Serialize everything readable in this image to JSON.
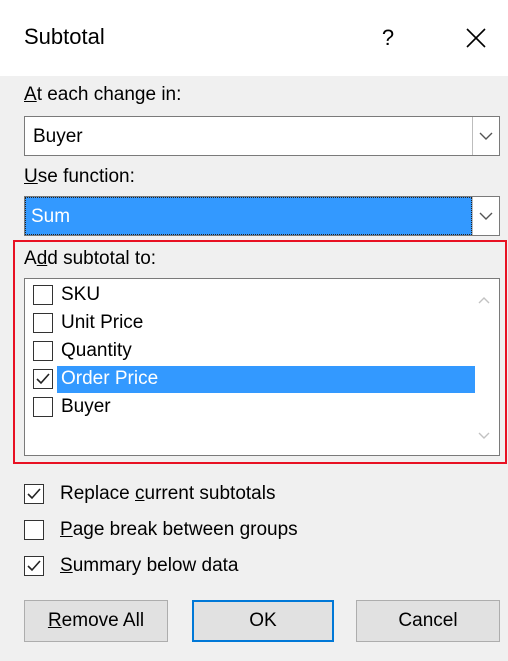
{
  "dialog": {
    "title": "Subtotal",
    "help_label": "?"
  },
  "change": {
    "label_access": "A",
    "label_rest": "t each change in:",
    "value": "Buyer"
  },
  "function": {
    "label_access": "U",
    "label_rest": "se function:",
    "value": "Sum"
  },
  "add_to": {
    "label_pre": "A",
    "label_access": "d",
    "label_rest": "d subtotal to:",
    "items": [
      {
        "label": "SKU",
        "checked": false
      },
      {
        "label": "Unit Price",
        "checked": false
      },
      {
        "label": "Quantity",
        "checked": false
      },
      {
        "label": "Order Price",
        "checked": true,
        "selected": true
      },
      {
        "label": "Buyer",
        "checked": false
      }
    ]
  },
  "options": {
    "replace": {
      "pre": "Replace ",
      "access": "c",
      "rest": "urrent subtotals",
      "checked": true
    },
    "page_break": {
      "pre": "",
      "access": "P",
      "rest": "age break between groups",
      "checked": false
    },
    "summary": {
      "pre": "",
      "access": "S",
      "rest": "ummary below data",
      "checked": true
    }
  },
  "buttons": {
    "remove_access": "R",
    "remove_rest": "emove All",
    "ok": "OK",
    "cancel": "Cancel"
  },
  "colors": {
    "selection": "#3399ff",
    "highlight_frame": "#e81123",
    "default_button_border": "#0078d7"
  }
}
